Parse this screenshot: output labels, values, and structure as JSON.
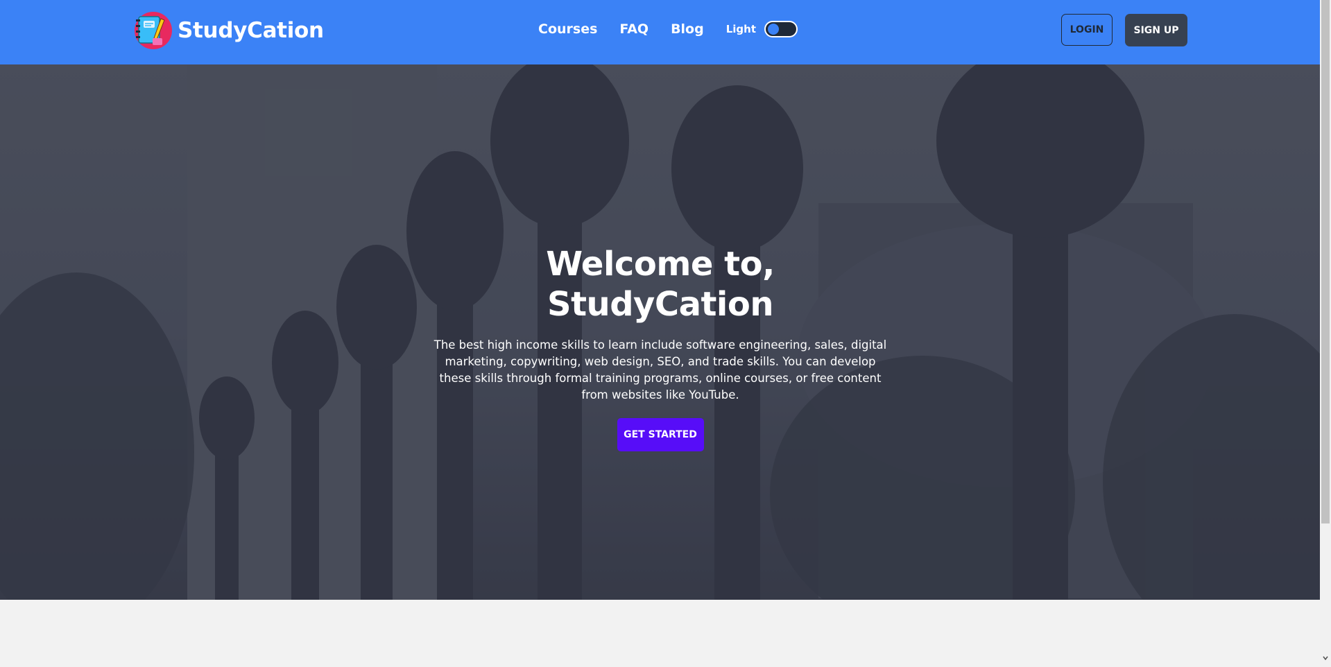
{
  "brand": {
    "name": "StudyCation",
    "logo_icon": "notebook-pencil-icon",
    "colors": {
      "circle": "#e8295f",
      "notebook": "#38bdf8",
      "pencil": "#facc15"
    }
  },
  "nav": {
    "links": [
      "Courses",
      "FAQ",
      "Blog"
    ],
    "theme_label": "Light",
    "toggle_icon": "toggle-switch-icon"
  },
  "auth": {
    "login": "LOGIN",
    "signup": "SIGN UP"
  },
  "hero": {
    "title": "Welcome to, StudyCation",
    "description": "The best high income skills to learn include software engineering, sales, digital marketing, copywriting, web design, SEO, and trade skills. You can develop these skills through formal training programs, online courses, or free content from websites like YouTube.",
    "cta": "GET STARTED",
    "background_image": "ornate-lampposts-photo"
  },
  "colors": {
    "navbar": "#3b82f6",
    "cta": "#570df8",
    "signup": "#374151",
    "page_bg": "#f2f2f2"
  }
}
